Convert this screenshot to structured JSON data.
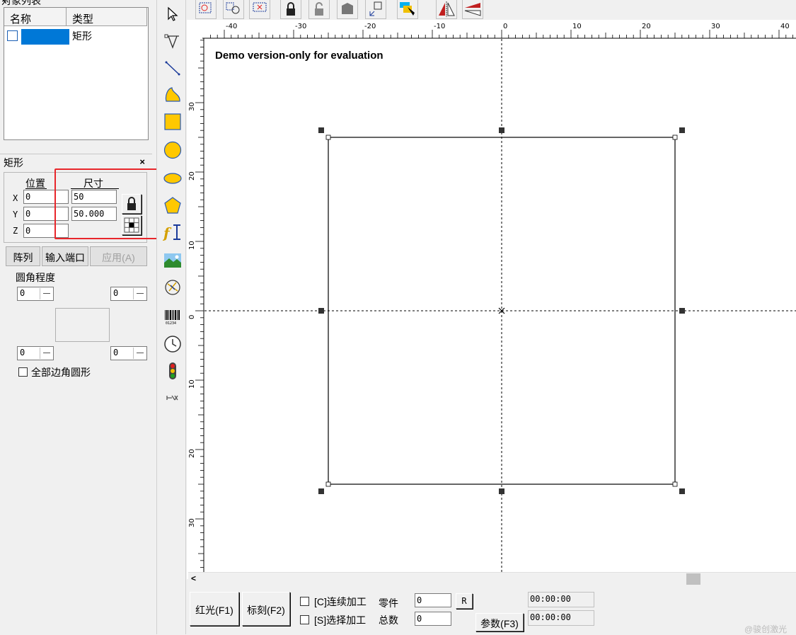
{
  "object_list": {
    "title": "对象列表",
    "close": "×",
    "col_name": "名称",
    "col_type": "类型",
    "rows": [
      {
        "type": "矩形"
      }
    ]
  },
  "props": {
    "title": "矩形",
    "close": "×",
    "position_label": "位置",
    "size_label": "尺寸",
    "x_label": "X",
    "y_label": "Y",
    "z_label": "Z",
    "x_pos": "0",
    "y_pos": "0",
    "z_pos": "0",
    "width": "50",
    "height": "50.000",
    "array_btn": "阵列",
    "input_port_btn": "输入端口",
    "apply_btn": "应用(A)",
    "corner_label": "圆角程度",
    "corner_tl": "0",
    "corner_tr": "0",
    "corner_bl": "0",
    "corner_br": "0",
    "all_round_label": "全部边角圆形"
  },
  "canvas": {
    "demo_text": "Demo version-only for evaluation",
    "ruler_top_labels": [
      "-40",
      "-30",
      "-20",
      "-10",
      "0",
      "10",
      "20",
      "30",
      "40"
    ],
    "ruler_left_labels": [
      "30",
      "20",
      "10",
      "0",
      "10",
      "20",
      "30"
    ],
    "rectangle": {
      "width_mm": 50,
      "height_mm": 50
    }
  },
  "bottom": {
    "red_light_btn": "红光(F1)",
    "mark_btn": "标刻(F2)",
    "continuous_label": "[C]连续加工",
    "select_label": "[S]选择加工",
    "parts_label": "零件",
    "total_label": "总数",
    "parts_value": "0",
    "total_value": "0",
    "reset_btn": "R",
    "params_btn": "参数(F3)",
    "time1": "00:00:00",
    "time2": "00:00:00"
  },
  "watermark": "@骏创激光",
  "colors": {
    "selection": "#0078d7",
    "highlight": "#e8262b"
  },
  "icons": {
    "left_toolbar": [
      "pointer-icon",
      "node-edit-icon",
      "line-icon",
      "curve-icon",
      "rectangle-icon",
      "circle-icon",
      "ellipse-icon",
      "polygon-icon",
      "text-icon",
      "bitmap-icon",
      "vector-file-icon",
      "barcode-icon",
      "timer-icon",
      "input-signal-icon",
      "output-signal-icon"
    ]
  }
}
